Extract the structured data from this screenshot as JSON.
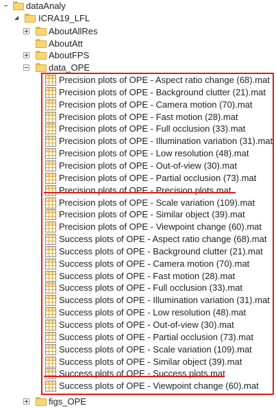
{
  "tree": {
    "root": {
      "label": "dataAnaly"
    },
    "project": {
      "label": "ICRA19_LFL"
    },
    "folders": {
      "about_all_res": "AboutAllRes",
      "about_att": "AboutAtt",
      "about_fps": "AboutFPS",
      "data_ope": "data_OPE",
      "figs_ope": "figs_OPE"
    },
    "files": [
      "Precision plots of OPE - Aspect ratio change (68).mat",
      "Precision plots of OPE - Background clutter (21).mat",
      "Precision plots of OPE - Camera motion (70).mat",
      "Precision plots of OPE - Fast motion (28).mat",
      "Precision plots of OPE - Full occlusion (33).mat",
      "Precision plots of OPE - Illumination variation (31).mat",
      "Precision plots of OPE - Low resolution (48).mat",
      "Precision plots of OPE - Out-of-view (30).mat",
      "Precision plots of OPE - Partial occlusion (73).mat",
      "Precision plots of OPE - Precision plots.mat",
      "Precision plots of OPE - Scale variation (109).mat",
      "Precision plots of OPE - Similar object (39).mat",
      "Precision plots of OPE - Viewpoint change (60).mat",
      "Success plots of OPE - Aspect ratio change (68).mat",
      "Success plots of OPE - Background clutter (21).mat",
      "Success plots of OPE - Camera motion (70).mat",
      "Success plots of OPE - Fast motion (28).mat",
      "Success plots of OPE - Full occlusion (33).mat",
      "Success plots of OPE - Illumination variation (31).mat",
      "Success plots of OPE - Low resolution (48).mat",
      "Success plots of OPE - Out-of-view (30).mat",
      "Success plots of OPE - Partial occlusion (73).mat",
      "Success plots of OPE - Scale variation (109).mat",
      "Success plots of OPE - Similar object (39).mat",
      "Success plots of OPE - Success plots.mat",
      "Success plots of OPE - Viewpoint change (60).mat"
    ],
    "struck_out_files": [
      "Precision plots of OPE - Precision plots.mat",
      "Success plots of OPE - Success plots.mat"
    ]
  },
  "icons": {
    "folder": "folder-icon",
    "file": "mat-file-icon",
    "expand": "expand-plus-icon",
    "collapse": "collapse-minus-icon"
  },
  "colors": {
    "annotation": "#e01a1a",
    "folder": "#f7d774",
    "text": "#1e1e1e"
  }
}
